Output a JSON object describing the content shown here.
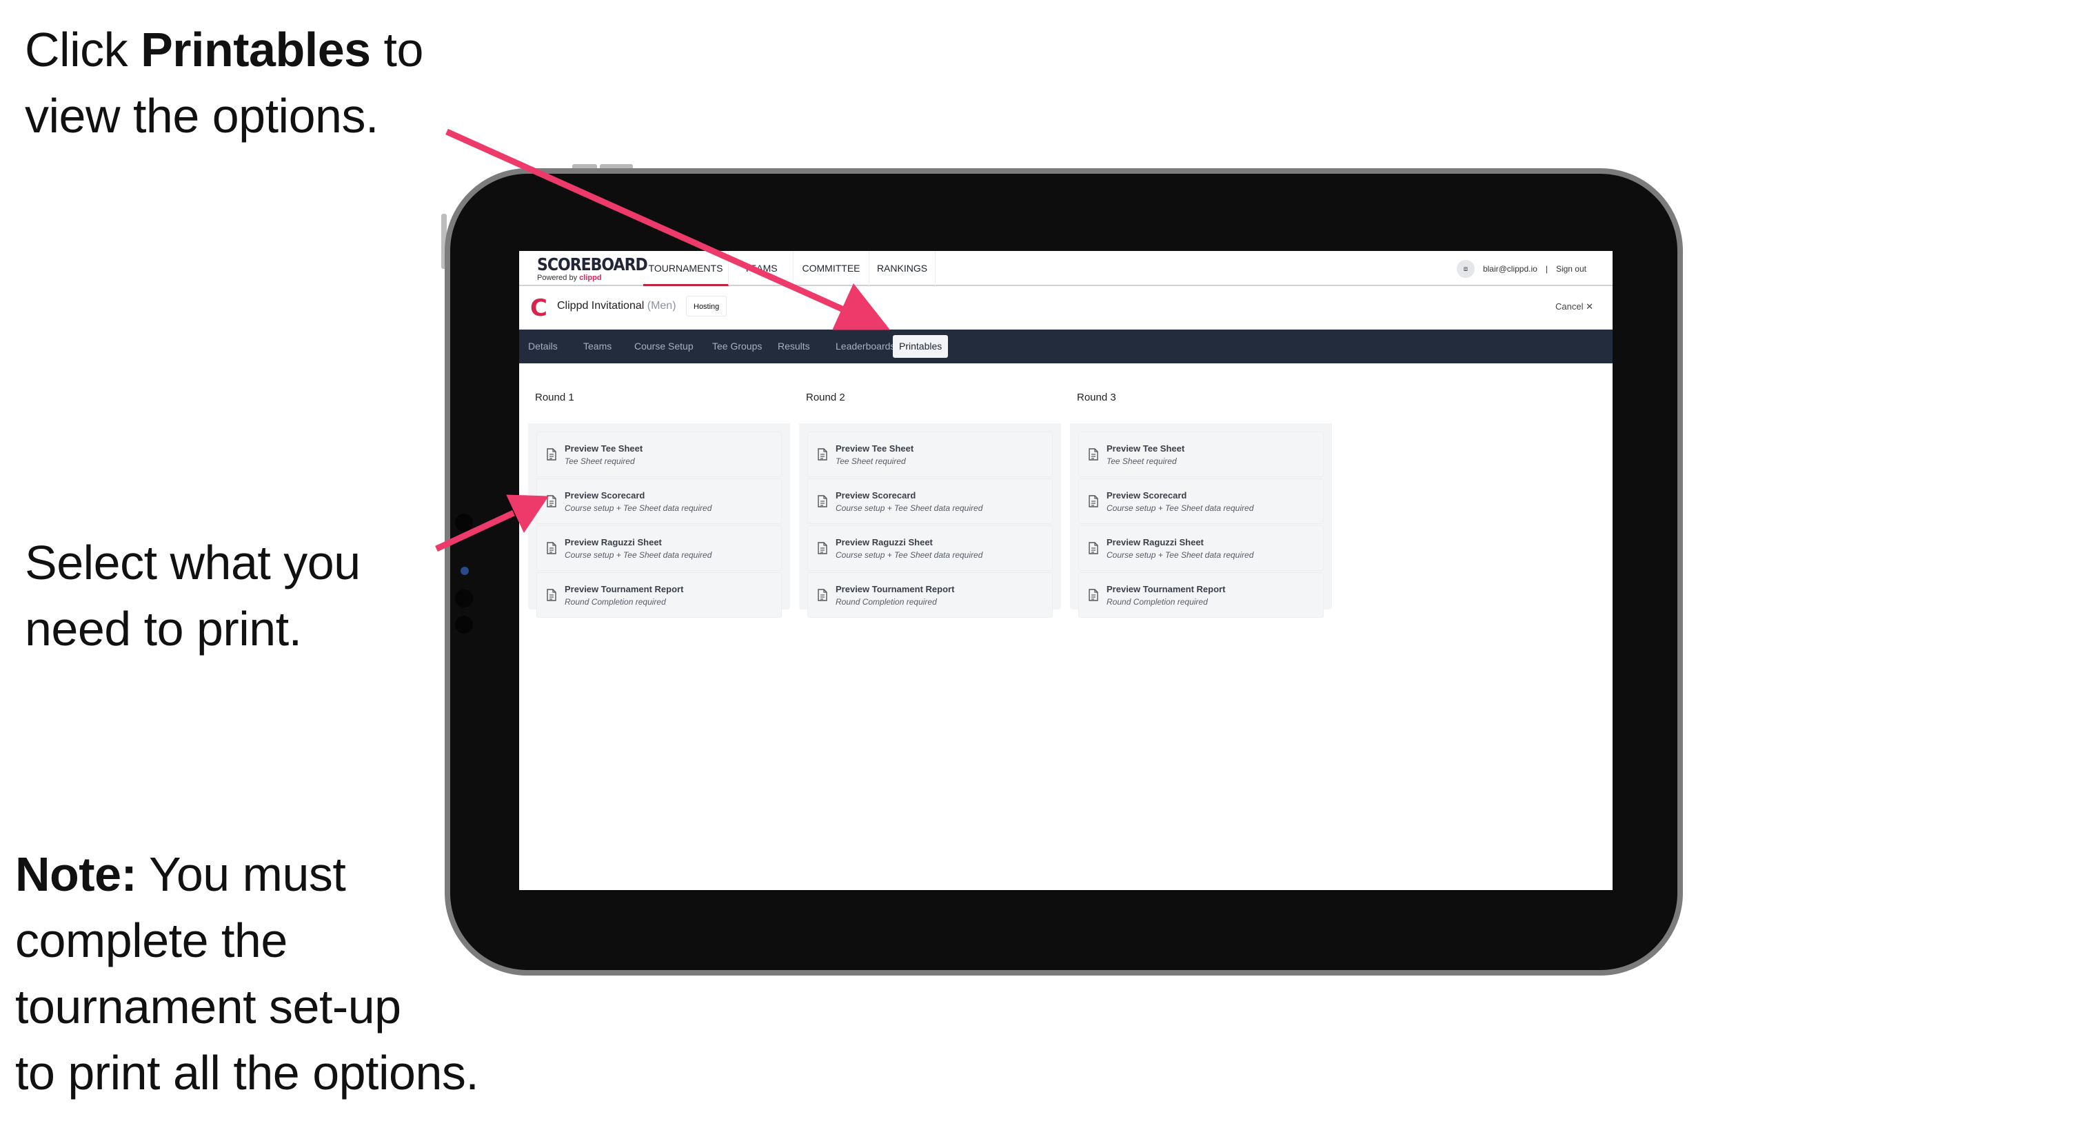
{
  "annotations": {
    "step1": {
      "prefix": "Click ",
      "bold": "Printables",
      "suffix": " to",
      "line2": "view the options."
    },
    "step2": {
      "line1": "Select what you",
      "line2": "need to print."
    },
    "note": {
      "bold": "Note:",
      "line1": " You must",
      "line2": "complete the",
      "line3": "tournament set-up",
      "line4": "to print all the options."
    }
  },
  "app": {
    "logo": {
      "main": "SCOREBOARD",
      "powered_by": "Powered by ",
      "brand": "clippd"
    },
    "nav": [
      {
        "label": "TOURNAMENTS",
        "active": true
      },
      {
        "label": "TEAMS",
        "active": false
      },
      {
        "label": "COMMITTEE",
        "active": false
      },
      {
        "label": "RANKINGS",
        "active": false
      }
    ],
    "user": {
      "avatar_icon": "image-placeholder-icon",
      "email": "blair@clippd.io",
      "separator": "|",
      "sign_out": "Sign out"
    },
    "tournament": {
      "logo_letter": "C",
      "name": "Clippd Invitational",
      "division": "(Men)",
      "badge": "Hosting",
      "cancel": "Cancel",
      "cancel_icon": "✕"
    },
    "tabs": [
      {
        "label": "Details",
        "active": false
      },
      {
        "label": "Teams",
        "active": false
      },
      {
        "label": "Course Setup",
        "active": false
      },
      {
        "label": "Tee Groups",
        "active": false
      },
      {
        "label": "Results",
        "active": false
      },
      {
        "label": "Leaderboards",
        "active": false
      },
      {
        "label": "Printables",
        "active": true
      }
    ],
    "rounds": [
      {
        "title": "Round 1",
        "items": [
          {
            "title": "Preview Tee Sheet",
            "sub": "Tee Sheet required"
          },
          {
            "title": "Preview Scorecard",
            "sub": "Course setup + Tee Sheet data required"
          },
          {
            "title": "Preview Raguzzi Sheet",
            "sub": "Course setup + Tee Sheet data required"
          },
          {
            "title": "Preview Tournament Report",
            "sub": "Round Completion required"
          }
        ]
      },
      {
        "title": "Round 2",
        "items": [
          {
            "title": "Preview Tee Sheet",
            "sub": "Tee Sheet required"
          },
          {
            "title": "Preview Scorecard",
            "sub": "Course setup + Tee Sheet data required"
          },
          {
            "title": "Preview Raguzzi Sheet",
            "sub": "Course setup + Tee Sheet data required"
          },
          {
            "title": "Preview Tournament Report",
            "sub": "Round Completion required"
          }
        ]
      },
      {
        "title": "Round 3",
        "items": [
          {
            "title": "Preview Tee Sheet",
            "sub": "Tee Sheet required"
          },
          {
            "title": "Preview Scorecard",
            "sub": "Course setup + Tee Sheet data required"
          },
          {
            "title": "Preview Raguzzi Sheet",
            "sub": "Course setup + Tee Sheet data required"
          },
          {
            "title": "Preview Tournament Report",
            "sub": "Round Completion required"
          }
        ]
      }
    ]
  },
  "colors": {
    "arrow": "#ee3a6b",
    "accent": "#d6244b",
    "tabbar": "#232c3d"
  }
}
